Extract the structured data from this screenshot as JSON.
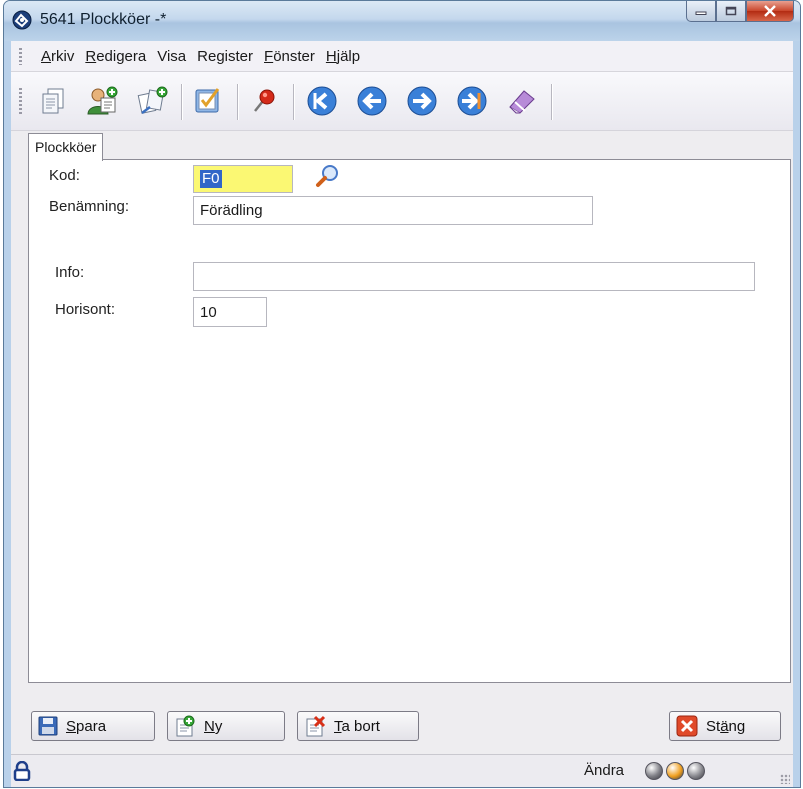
{
  "window": {
    "title": "5641 Plockköer -*"
  },
  "menu": [
    {
      "pre": "",
      "key": "A",
      "rest": "rkiv"
    },
    {
      "pre": "",
      "key": "R",
      "rest": "edigera"
    },
    {
      "pre": "Visa",
      "key": "",
      "rest": ""
    },
    {
      "pre": "Register",
      "key": "",
      "rest": ""
    },
    {
      "pre": "",
      "key": "F",
      "rest": "önster"
    },
    {
      "pre": "",
      "key": "H",
      "rest": "jälp"
    }
  ],
  "toolbar": {
    "icons": [
      "document-icon",
      "user-add-icon",
      "transfer-add-icon",
      "note-check-icon",
      "pin-icon",
      "first-record-icon",
      "previous-record-icon",
      "next-record-icon",
      "last-record-icon",
      "eraser-icon"
    ]
  },
  "tab": {
    "label": "Plockköer"
  },
  "form": {
    "kod_label": "Kod:",
    "kod_value": "F0",
    "benamning_label": "Benämning:",
    "benamning_value": "Förädling",
    "info_label": "Info:",
    "info_value": "",
    "horisont_label": "Horisont:",
    "horisont_value": "10"
  },
  "buttons": {
    "save": {
      "key": "S",
      "rest": "para"
    },
    "new": {
      "key": "N",
      "rest": "y"
    },
    "delete": {
      "key": "T",
      "rest": "a bort"
    },
    "close": {
      "pre": "St",
      "key": "ä",
      "rest": "ng"
    }
  },
  "status": {
    "mode": "Ändra",
    "indicators": [
      "#7f7f86",
      "#f0a020",
      "#8a8a90"
    ]
  },
  "colors": {
    "accent": "#3166c8",
    "highlight_field": "#fbf873"
  }
}
